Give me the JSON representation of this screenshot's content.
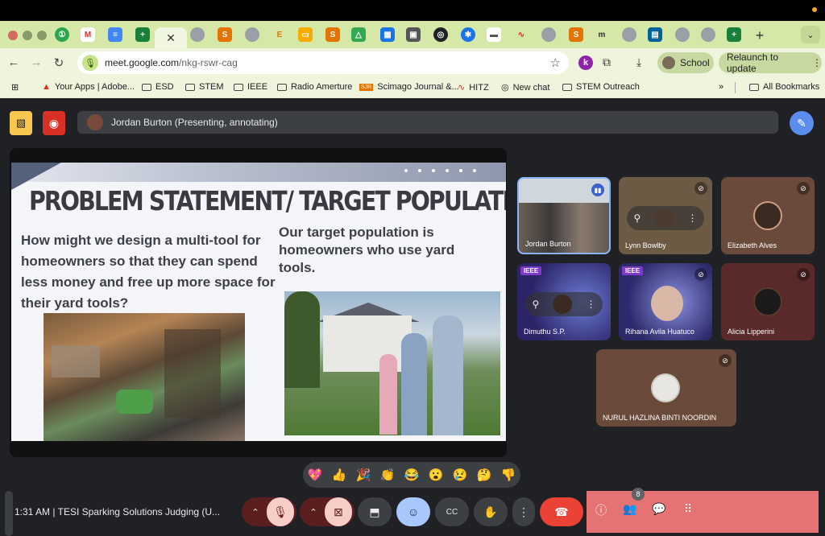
{
  "browser": {
    "active_tab_close": "✕",
    "new_tab": "+",
    "tab_menu": "⌄",
    "url_host": "meet.google.com",
    "url_path": "/nkg-rswr-cag",
    "profile_initial": "k",
    "profile_label": "School",
    "relaunch_label": "Relaunch to update",
    "bookmarks": [
      {
        "label": "Your Apps | Adobe..."
      },
      {
        "label": "ESD"
      },
      {
        "label": "STEM"
      },
      {
        "label": "IEEE"
      },
      {
        "label": "Radio Amerture"
      },
      {
        "label": "Scimago Journal &..."
      },
      {
        "label": "HITZ"
      },
      {
        "label": "New chat"
      },
      {
        "label": "STEM Outreach"
      }
    ],
    "overflow": "»",
    "all_bookmarks": "All Bookmarks"
  },
  "meet": {
    "presenting_text": "Jordan Burton (Presenting, annotating)",
    "slide": {
      "title": "PROBLEM STATEMENT/ TARGET POPULATION",
      "left_text": "How might we design a multi-tool for homeowners so that they can spend less money and free up more space for their yard tools?",
      "right_text": "Our target population is homeowners who use yard tools."
    },
    "participants": [
      {
        "name": "Jordan Burton"
      },
      {
        "name": "Lynn Bowlby"
      },
      {
        "name": "Elizabeth Alves"
      },
      {
        "name": "Dimuthu S.P.",
        "badge": "IEEE"
      },
      {
        "name": "Rihana Avila Huatuco",
        "badge": "IEEE"
      },
      {
        "name": "Alicia Lipperini"
      },
      {
        "name": "NURUL HAZLINA BINTI NOORDIN"
      }
    ],
    "reactions": [
      "💖",
      "👍",
      "🎉",
      "👏",
      "😂",
      "😮",
      "😢",
      "🤔",
      "👎"
    ],
    "clock": "1:31 AM",
    "meeting_title": "TESI Sparking Solutions Judging (U...",
    "people_count": "8",
    "colors": {
      "accent": "#5b8def",
      "danger": "#e57373",
      "end_call": "#ea4335"
    }
  }
}
